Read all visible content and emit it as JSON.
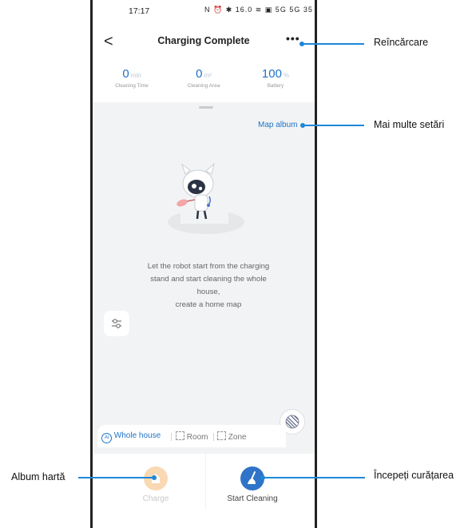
{
  "statusbar": {
    "time": "17:17",
    "icons_text": "N ⏰ ✱ 16.0 ≋ ▣ 5G 5G 35"
  },
  "navbar": {
    "back_symbol": "<",
    "title": "Charging Complete",
    "more_symbol": "•••"
  },
  "stats": [
    {
      "value": "0",
      "unit": "min",
      "label": "Cleaning Time"
    },
    {
      "value": "0",
      "unit": "m²",
      "label": "Cleaning Area"
    },
    {
      "value": "100",
      "unit": "%",
      "label": "Battery"
    }
  ],
  "map": {
    "album_link": "Map album",
    "message_lines": [
      "Let the robot start from the charging",
      "stand and start cleaning the whole",
      "house,",
      "create a home map"
    ]
  },
  "modes": {
    "whole_house": "Whole house",
    "room": "Room",
    "zone": "Zone",
    "selected": "Whole house"
  },
  "bottom": {
    "charge_label": "Charge",
    "start_label": "Start Cleaning"
  },
  "annotations": {
    "recharge": "Reîncărcare",
    "more_settings": "Mai multe setări",
    "map_album": "Album hartă",
    "start_cleaning": "Începeți curățarea"
  },
  "colors": {
    "accent": "#1e73c8",
    "annotation": "#1e88d8",
    "charge": "#f9d9b3",
    "start": "#2f74c8"
  },
  "icons": [
    "back-arrow-icon",
    "more-dots-icon",
    "robot-mascot-illustration",
    "filter-sliders-icon",
    "striped-circle-icon",
    "ai-icon",
    "room-icon",
    "zone-icon",
    "charge-home-icon",
    "broom-icon"
  ]
}
